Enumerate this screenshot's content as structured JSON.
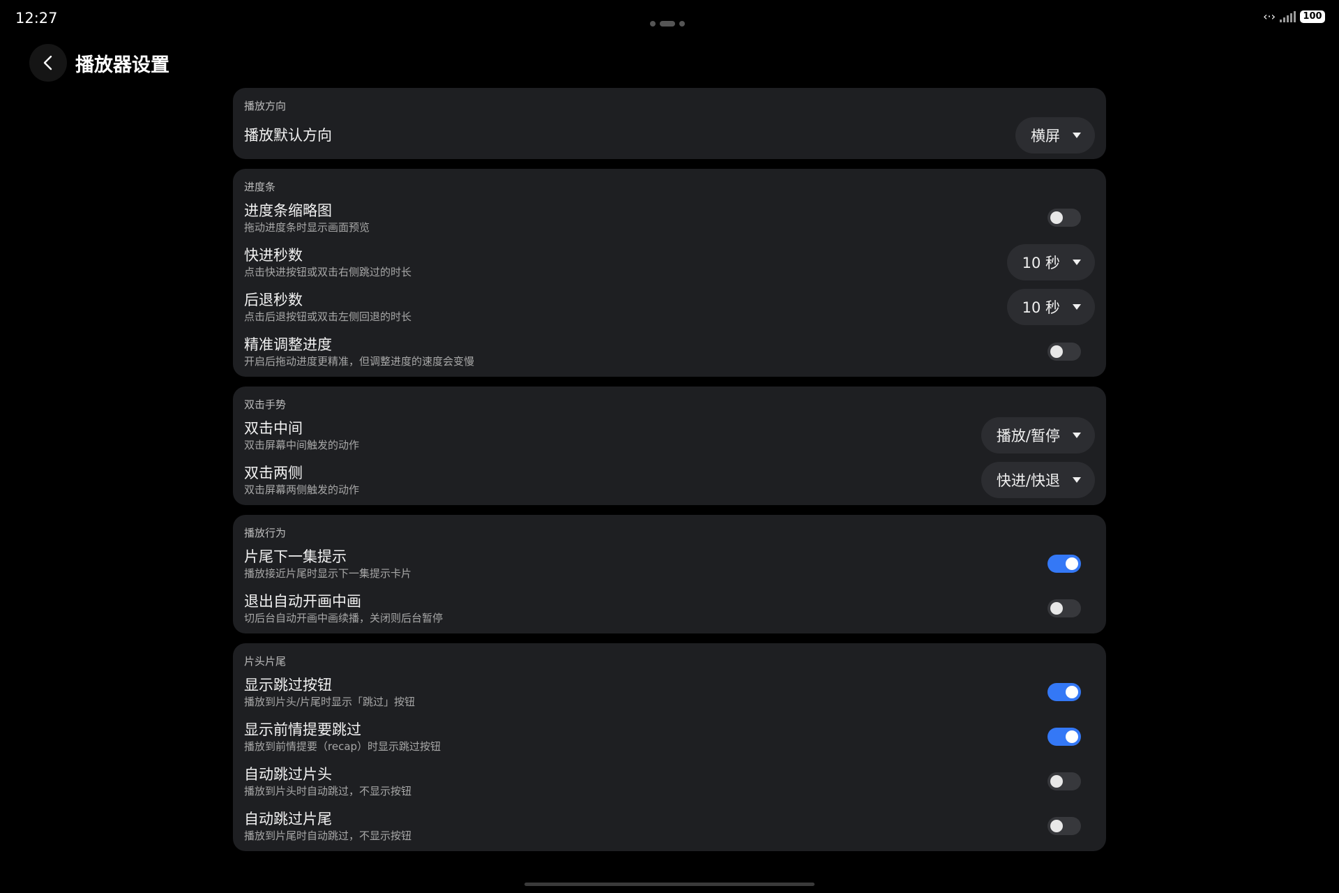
{
  "status": {
    "time": "12:27",
    "code_icon": "‹·›",
    "battery": "100"
  },
  "header": {
    "title": "播放器设置"
  },
  "sections": [
    {
      "title": "播放方向",
      "rows": [
        {
          "label": "播放默认方向",
          "control": "dropdown",
          "value": "横屏"
        }
      ]
    },
    {
      "title": "进度条",
      "rows": [
        {
          "label": "进度条缩略图",
          "desc": "拖动进度条时显示画面预览",
          "control": "toggle",
          "on": false
        },
        {
          "label": "快进秒数",
          "desc": "点击快进按钮或双击右侧跳过的时长",
          "control": "dropdown",
          "value": "10 秒"
        },
        {
          "label": "后退秒数",
          "desc": "点击后退按钮或双击左侧回退的时长",
          "control": "dropdown",
          "value": "10 秒"
        },
        {
          "label": "精准调整进度",
          "desc": "开启后拖动进度更精准，但调整进度的速度会变慢",
          "control": "toggle",
          "on": false
        }
      ]
    },
    {
      "title": "双击手势",
      "rows": [
        {
          "label": "双击中间",
          "desc": "双击屏幕中间触发的动作",
          "control": "dropdown",
          "value": "播放/暂停"
        },
        {
          "label": "双击两侧",
          "desc": "双击屏幕两侧触发的动作",
          "control": "dropdown",
          "value": "快进/快退"
        }
      ]
    },
    {
      "title": "播放行为",
      "rows": [
        {
          "label": "片尾下一集提示",
          "desc": "播放接近片尾时显示下一集提示卡片",
          "control": "toggle",
          "on": true
        },
        {
          "label": "退出自动开画中画",
          "desc": "切后台自动开画中画续播，关闭则后台暂停",
          "control": "toggle",
          "on": false
        }
      ]
    },
    {
      "title": "片头片尾",
      "rows": [
        {
          "label": "显示跳过按钮",
          "desc": "播放到片头/片尾时显示「跳过」按钮",
          "control": "toggle",
          "on": true
        },
        {
          "label": "显示前情提要跳过",
          "desc": "播放到前情提要（recap）时显示跳过按钮",
          "control": "toggle",
          "on": true
        },
        {
          "label": "自动跳过片头",
          "desc": "播放到片头时自动跳过，不显示按钮",
          "control": "toggle",
          "on": false
        },
        {
          "label": "自动跳过片尾",
          "desc": "播放到片尾时自动跳过，不显示按钮",
          "control": "toggle",
          "on": false
        }
      ]
    }
  ],
  "colors": {
    "background": "#000000",
    "card": "#1E1F22",
    "toggle_on": "#3478F6",
    "toggle_off": "#37383C",
    "dropdown": "#2C2D31"
  }
}
